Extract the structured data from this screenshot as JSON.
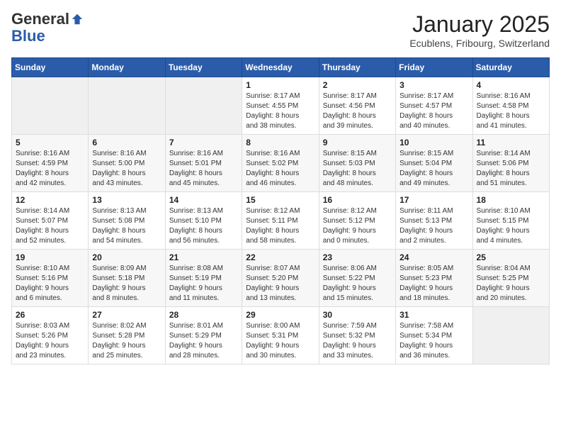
{
  "logo": {
    "general": "General",
    "blue": "Blue"
  },
  "header": {
    "month": "January 2025",
    "location": "Ecublens, Fribourg, Switzerland"
  },
  "days_of_week": [
    "Sunday",
    "Monday",
    "Tuesday",
    "Wednesday",
    "Thursday",
    "Friday",
    "Saturday"
  ],
  "weeks": [
    [
      {
        "day": "",
        "info": ""
      },
      {
        "day": "",
        "info": ""
      },
      {
        "day": "",
        "info": ""
      },
      {
        "day": "1",
        "info": "Sunrise: 8:17 AM\nSunset: 4:55 PM\nDaylight: 8 hours\nand 38 minutes."
      },
      {
        "day": "2",
        "info": "Sunrise: 8:17 AM\nSunset: 4:56 PM\nDaylight: 8 hours\nand 39 minutes."
      },
      {
        "day": "3",
        "info": "Sunrise: 8:17 AM\nSunset: 4:57 PM\nDaylight: 8 hours\nand 40 minutes."
      },
      {
        "day": "4",
        "info": "Sunrise: 8:16 AM\nSunset: 4:58 PM\nDaylight: 8 hours\nand 41 minutes."
      }
    ],
    [
      {
        "day": "5",
        "info": "Sunrise: 8:16 AM\nSunset: 4:59 PM\nDaylight: 8 hours\nand 42 minutes."
      },
      {
        "day": "6",
        "info": "Sunrise: 8:16 AM\nSunset: 5:00 PM\nDaylight: 8 hours\nand 43 minutes."
      },
      {
        "day": "7",
        "info": "Sunrise: 8:16 AM\nSunset: 5:01 PM\nDaylight: 8 hours\nand 45 minutes."
      },
      {
        "day": "8",
        "info": "Sunrise: 8:16 AM\nSunset: 5:02 PM\nDaylight: 8 hours\nand 46 minutes."
      },
      {
        "day": "9",
        "info": "Sunrise: 8:15 AM\nSunset: 5:03 PM\nDaylight: 8 hours\nand 48 minutes."
      },
      {
        "day": "10",
        "info": "Sunrise: 8:15 AM\nSunset: 5:04 PM\nDaylight: 8 hours\nand 49 minutes."
      },
      {
        "day": "11",
        "info": "Sunrise: 8:14 AM\nSunset: 5:06 PM\nDaylight: 8 hours\nand 51 minutes."
      }
    ],
    [
      {
        "day": "12",
        "info": "Sunrise: 8:14 AM\nSunset: 5:07 PM\nDaylight: 8 hours\nand 52 minutes."
      },
      {
        "day": "13",
        "info": "Sunrise: 8:13 AM\nSunset: 5:08 PM\nDaylight: 8 hours\nand 54 minutes."
      },
      {
        "day": "14",
        "info": "Sunrise: 8:13 AM\nSunset: 5:10 PM\nDaylight: 8 hours\nand 56 minutes."
      },
      {
        "day": "15",
        "info": "Sunrise: 8:12 AM\nSunset: 5:11 PM\nDaylight: 8 hours\nand 58 minutes."
      },
      {
        "day": "16",
        "info": "Sunrise: 8:12 AM\nSunset: 5:12 PM\nDaylight: 9 hours\nand 0 minutes."
      },
      {
        "day": "17",
        "info": "Sunrise: 8:11 AM\nSunset: 5:13 PM\nDaylight: 9 hours\nand 2 minutes."
      },
      {
        "day": "18",
        "info": "Sunrise: 8:10 AM\nSunset: 5:15 PM\nDaylight: 9 hours\nand 4 minutes."
      }
    ],
    [
      {
        "day": "19",
        "info": "Sunrise: 8:10 AM\nSunset: 5:16 PM\nDaylight: 9 hours\nand 6 minutes."
      },
      {
        "day": "20",
        "info": "Sunrise: 8:09 AM\nSunset: 5:18 PM\nDaylight: 9 hours\nand 8 minutes."
      },
      {
        "day": "21",
        "info": "Sunrise: 8:08 AM\nSunset: 5:19 PM\nDaylight: 9 hours\nand 11 minutes."
      },
      {
        "day": "22",
        "info": "Sunrise: 8:07 AM\nSunset: 5:20 PM\nDaylight: 9 hours\nand 13 minutes."
      },
      {
        "day": "23",
        "info": "Sunrise: 8:06 AM\nSunset: 5:22 PM\nDaylight: 9 hours\nand 15 minutes."
      },
      {
        "day": "24",
        "info": "Sunrise: 8:05 AM\nSunset: 5:23 PM\nDaylight: 9 hours\nand 18 minutes."
      },
      {
        "day": "25",
        "info": "Sunrise: 8:04 AM\nSunset: 5:25 PM\nDaylight: 9 hours\nand 20 minutes."
      }
    ],
    [
      {
        "day": "26",
        "info": "Sunrise: 8:03 AM\nSunset: 5:26 PM\nDaylight: 9 hours\nand 23 minutes."
      },
      {
        "day": "27",
        "info": "Sunrise: 8:02 AM\nSunset: 5:28 PM\nDaylight: 9 hours\nand 25 minutes."
      },
      {
        "day": "28",
        "info": "Sunrise: 8:01 AM\nSunset: 5:29 PM\nDaylight: 9 hours\nand 28 minutes."
      },
      {
        "day": "29",
        "info": "Sunrise: 8:00 AM\nSunset: 5:31 PM\nDaylight: 9 hours\nand 30 minutes."
      },
      {
        "day": "30",
        "info": "Sunrise: 7:59 AM\nSunset: 5:32 PM\nDaylight: 9 hours\nand 33 minutes."
      },
      {
        "day": "31",
        "info": "Sunrise: 7:58 AM\nSunset: 5:34 PM\nDaylight: 9 hours\nand 36 minutes."
      },
      {
        "day": "",
        "info": ""
      }
    ]
  ]
}
